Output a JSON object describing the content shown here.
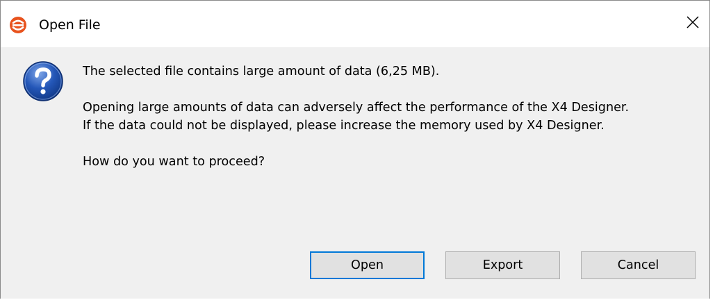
{
  "window": {
    "title": "Open File",
    "close_symbol": "×"
  },
  "icons": {
    "app": "app-logo-icon",
    "question": "question-icon",
    "close": "close-icon"
  },
  "message": {
    "line1": "The selected file contains large amount of data (6,25 MB).",
    "line2": "Opening large amounts of data can adversely affect the performance of the X4 Designer.",
    "line3": "If the data could not be displayed, please increase the memory used by X4 Designer.",
    "line4": "How do you want to proceed?"
  },
  "buttons": {
    "open": "Open",
    "export": "Export",
    "cancel": "Cancel",
    "default": "open"
  },
  "colors": {
    "app_icon": "#e8531e",
    "question_icon": "#2457b8",
    "default_button_border": "#0078d7"
  }
}
